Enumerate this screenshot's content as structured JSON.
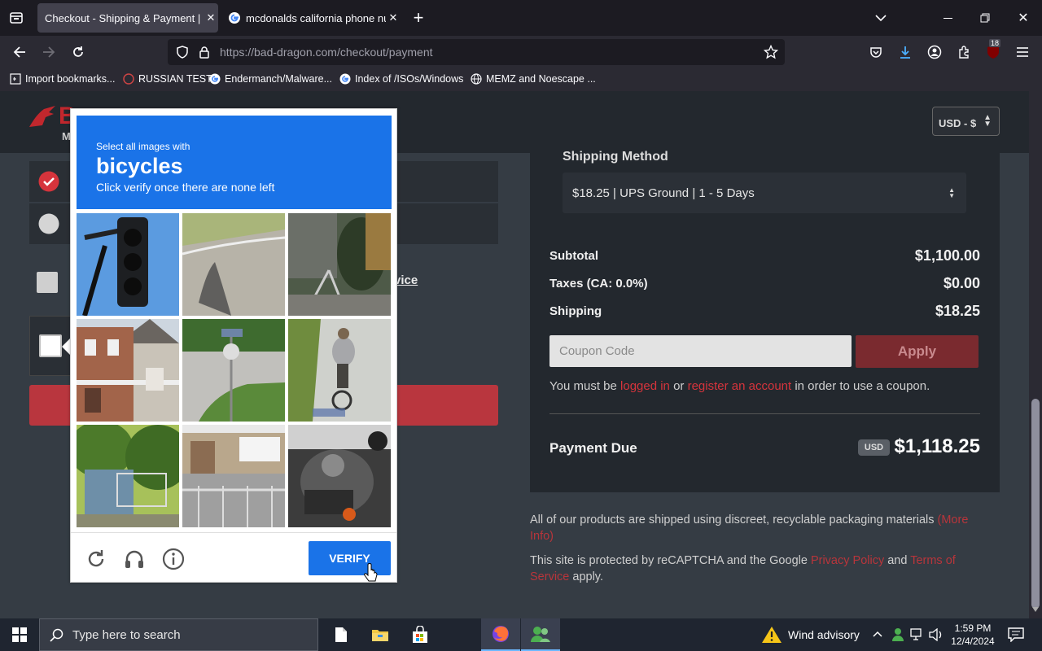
{
  "browser": {
    "tabs": [
      {
        "title": "Checkout - Shipping & Payment | B",
        "active": true
      },
      {
        "title": "mcdonalds california phone nu",
        "active": false
      }
    ],
    "url_domain": "https://bad-dragon.com",
    "url_path": "/checkout/payment",
    "extension_badge": "18",
    "bookmarks": [
      "Import bookmarks...",
      "RUSSIAN TEST",
      "Endermanch/Malware...",
      "Index of /ISOs/Windows",
      "MEMZ and Noescape ..."
    ]
  },
  "site": {
    "logo_text": "B",
    "logo_sub": "M",
    "currency": "USD - $",
    "privacy_link": "vice"
  },
  "summary": {
    "shipping_heading": "Shipping Method",
    "shipping_option": "$18.25 | UPS Ground | 1 - 5 Days",
    "subtotal_label": "Subtotal",
    "subtotal_value": "$1,100.00",
    "taxes_label": "Taxes (CA: 0.0%)",
    "taxes_value": "$0.00",
    "shipping_label": "Shipping",
    "shipping_value": "$18.25",
    "coupon_placeholder": "Coupon Code",
    "apply_label": "Apply",
    "coupon_note_1": "You must be ",
    "coupon_link_login": "logged in",
    "coupon_note_2": " or ",
    "coupon_link_register": "register an account",
    "coupon_note_3": " in order to use a coupon.",
    "due_label": "Payment Due",
    "due_currency": "USD",
    "due_value": "$1,118.25"
  },
  "footnotes": {
    "shipping_text": "All of our products are shipped using discreet, recyclable packaging materials ",
    "shipping_link": "(More Info)",
    "recaptcha_text_1": "This site is protected by reCAPTCHA and the Google ",
    "recaptcha_link_privacy": "Privacy Policy",
    "recaptcha_text_2": " and ",
    "recaptcha_link_terms": "Terms of Service",
    "recaptcha_text_3": " apply."
  },
  "captcha": {
    "instruction": "Select all images with",
    "keyword": "bicycles",
    "hint": "Click verify once there are none left",
    "verify_label": "VERIFY",
    "tiles": [
      "traffic light",
      "road with shadow",
      "house railing",
      "brick house",
      "street corner",
      "person on bicycle",
      "trees and fence",
      "metal fence",
      "bus interior"
    ]
  },
  "taskbar": {
    "search_placeholder": "Type here to search",
    "weather": "Wind advisory",
    "time": "1:59 PM",
    "date": "12/4/2024"
  },
  "colors": {
    "accent_red": "#d6343c",
    "captcha_blue": "#1a73e8",
    "page_bg": "#353c44",
    "panel_bg": "#23282e"
  }
}
